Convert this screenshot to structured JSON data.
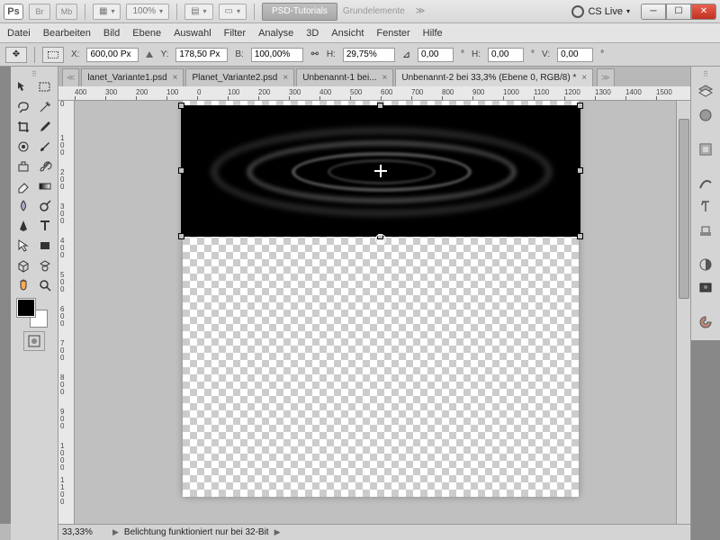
{
  "titlebar": {
    "app_abbrev": "Ps",
    "br": "Br",
    "mb": "Mb",
    "zoom": "100%",
    "psd_tutorials": "PSD-Tutorials",
    "grundelemente": "Grundelemente",
    "cslive": "CS Live"
  },
  "menu": [
    "Datei",
    "Bearbeiten",
    "Bild",
    "Ebene",
    "Auswahl",
    "Filter",
    "Analyse",
    "3D",
    "Ansicht",
    "Fenster",
    "Hilfe"
  ],
  "options": {
    "x_label": "X:",
    "x_value": "600,00 Px",
    "y_label": "Y:",
    "y_value": "178,50 Px",
    "w_label": "B:",
    "w_value": "100,00%",
    "h_label": "H:",
    "h_value": "29,75%",
    "angle_label": "",
    "angle_value": "0,00",
    "skew_h_label": "H:",
    "skew_h_value": "0,00",
    "deg1": "°",
    "skew_v_label": "V:",
    "skew_v_value": "0,00",
    "deg2": "°"
  },
  "tabs": [
    {
      "label": "lanet_Variante1.psd",
      "active": false
    },
    {
      "label": "Planet_Variante2.psd",
      "active": false
    },
    {
      "label": "Unbenannt-1 bei...",
      "active": false
    },
    {
      "label": "Unbenannt-2 bei 33,3% (Ebene 0, RGB/8) *",
      "active": true
    }
  ],
  "ruler_h": [
    "400",
    "300",
    "200",
    "100",
    "0",
    "100",
    "200",
    "300",
    "400",
    "500",
    "600",
    "700",
    "800",
    "900",
    "1000",
    "1100",
    "1200",
    "1300",
    "1400",
    "1500"
  ],
  "ruler_v": [
    "0",
    "1 0 0",
    "2 0 0",
    "3 0 0",
    "4 0 0",
    "5 0 0",
    "6 0 0",
    "7 0 0",
    "8 0 0",
    "9 0 0",
    "1 0 0 0",
    "1 1 0 0"
  ],
  "status": {
    "zoom": "33,33%",
    "msg": "Belichtung funktioniert nur bei 32-Bit"
  },
  "tools": [
    [
      "move",
      "marquee-rect"
    ],
    [
      "lasso",
      "magic-wand"
    ],
    [
      "crop",
      "eyedropper"
    ],
    [
      "spot-heal",
      "brush"
    ],
    [
      "clone",
      "history-brush"
    ],
    [
      "eraser",
      "gradient"
    ],
    [
      "blur",
      "dodge"
    ],
    [
      "pen",
      "type"
    ],
    [
      "path-select",
      "shape"
    ],
    [
      "3d-object",
      "3d-camera"
    ],
    [
      "hand",
      "zoom"
    ]
  ],
  "dock": [
    "layers",
    "adjustments",
    "paragraphs",
    "swatches",
    "color",
    "styles",
    "character",
    "brightness",
    "camera",
    "palette"
  ]
}
